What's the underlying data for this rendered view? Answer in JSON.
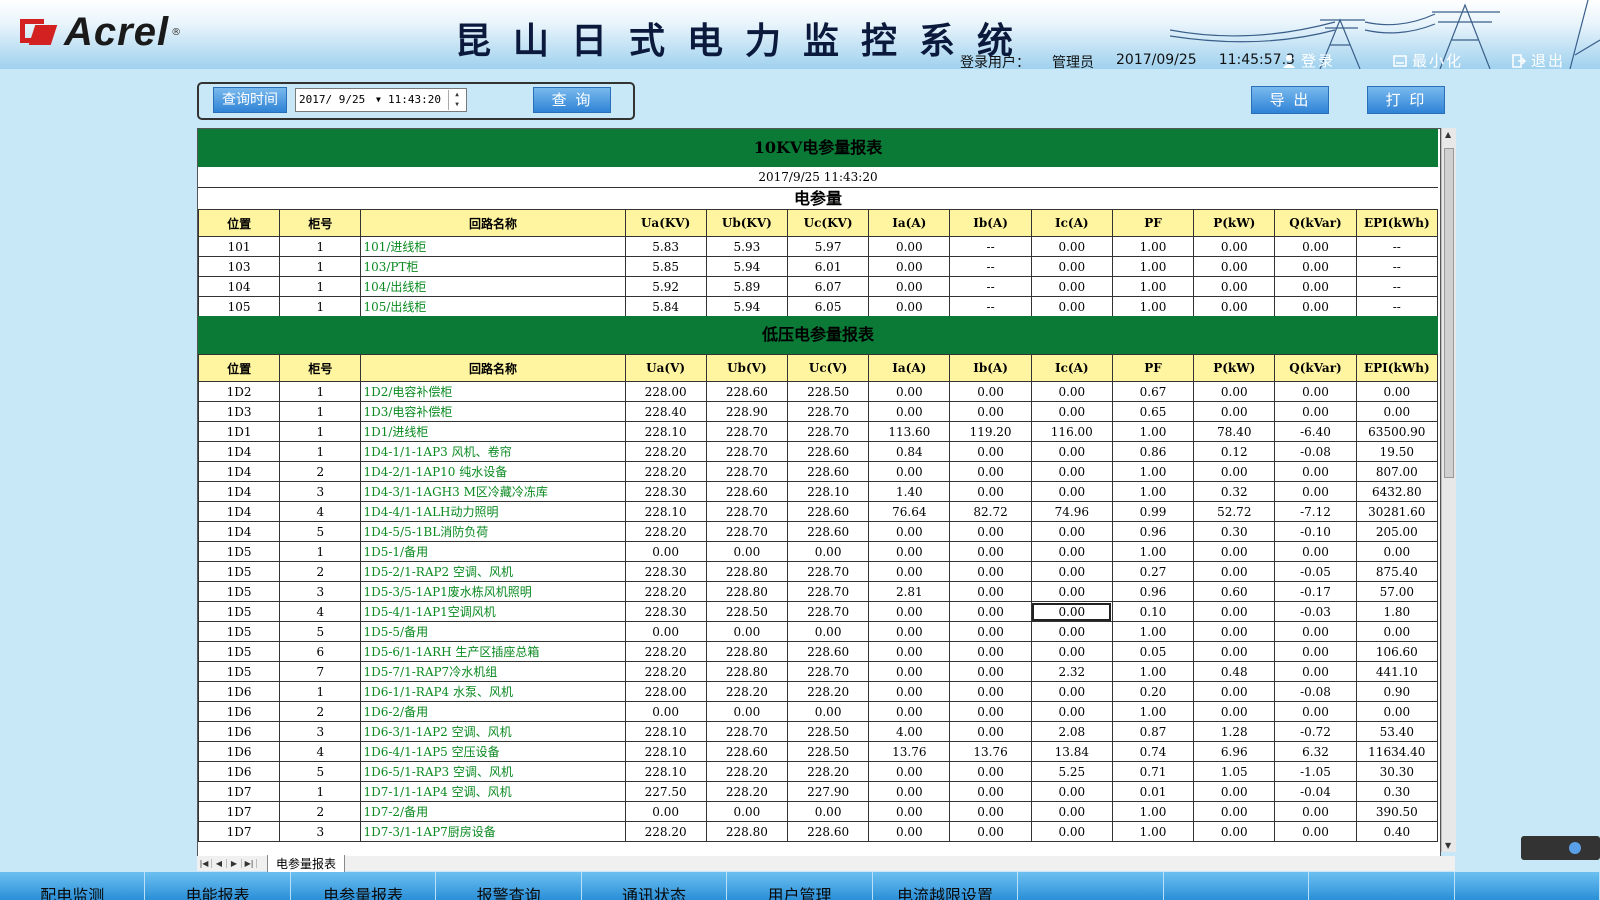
{
  "header": {
    "logo_text": "Acrel",
    "logo_reg": "®",
    "title": "昆山日式电力监控系统",
    "user_label": "登录用户：",
    "user_name": "管理员",
    "date": "2017/09/25",
    "time": "11:45:57.3",
    "login_label": "登录",
    "minimize_label": "最小化",
    "exit_label": "退出"
  },
  "query": {
    "label": "查询时间",
    "date_value": "2017/ 9/25",
    "time_value": "11:43:20",
    "query_button": "查 询",
    "export_button": "导 出",
    "print_button": "打 印"
  },
  "report": {
    "hv_title": "10KV电参量报表",
    "timestamp": "2017/9/25 11:43:20",
    "section_label": "电参量",
    "hv_columns": [
      "位置",
      "柜号",
      "回路名称",
      "Ua(KV)",
      "Ub(KV)",
      "Uc(KV)",
      "Ia(A)",
      "Ib(A)",
      "Ic(A)",
      "PF",
      "P(kW)",
      "Q(kVar)",
      "EPI(kWh)"
    ],
    "hv_rows": [
      [
        "101",
        "1",
        "101/进线柜",
        "5.83",
        "5.93",
        "5.97",
        "0.00",
        "--",
        "0.00",
        "1.00",
        "0.00",
        "0.00",
        "--"
      ],
      [
        "103",
        "1",
        "103/PT柜",
        "5.85",
        "5.94",
        "6.01",
        "0.00",
        "--",
        "0.00",
        "1.00",
        "0.00",
        "0.00",
        "--"
      ],
      [
        "104",
        "1",
        "104/出线柜",
        "5.92",
        "5.89",
        "6.07",
        "0.00",
        "--",
        "0.00",
        "1.00",
        "0.00",
        "0.00",
        "--"
      ],
      [
        "105",
        "1",
        "105/出线柜",
        "5.84",
        "5.94",
        "6.05",
        "0.00",
        "--",
        "0.00",
        "1.00",
        "0.00",
        "0.00",
        "--"
      ]
    ],
    "lv_title": "低压电参量报表",
    "lv_columns": [
      "位置",
      "柜号",
      "回路名称",
      "Ua(V)",
      "Ub(V)",
      "Uc(V)",
      "Ia(A)",
      "Ib(A)",
      "Ic(A)",
      "PF",
      "P(kW)",
      "Q(kVar)",
      "EPI(kWh)"
    ],
    "lv_rows": [
      [
        "1D2",
        "1",
        "1D2/电容补偿柜",
        "228.00",
        "228.60",
        "228.50",
        "0.00",
        "0.00",
        "0.00",
        "0.67",
        "0.00",
        "0.00",
        "0.00"
      ],
      [
        "1D3",
        "1",
        "1D3/电容补偿柜",
        "228.40",
        "228.90",
        "228.70",
        "0.00",
        "0.00",
        "0.00",
        "0.65",
        "0.00",
        "0.00",
        "0.00"
      ],
      [
        "1D1",
        "1",
        "1D1/进线柜",
        "228.10",
        "228.70",
        "228.70",
        "113.60",
        "119.20",
        "116.00",
        "1.00",
        "78.40",
        "-6.40",
        "63500.90"
      ],
      [
        "1D4",
        "1",
        "1D4-1/1-1AP3 风机、卷帘",
        "228.20",
        "228.70",
        "228.60",
        "0.84",
        "0.00",
        "0.00",
        "0.86",
        "0.12",
        "-0.08",
        "19.50"
      ],
      [
        "1D4",
        "2",
        "1D4-2/1-1AP10 纯水设备",
        "228.20",
        "228.70",
        "228.60",
        "0.00",
        "0.00",
        "0.00",
        "1.00",
        "0.00",
        "0.00",
        "807.00"
      ],
      [
        "1D4",
        "3",
        "1D4-3/1-1AGH3 M区冷藏冷冻库",
        "228.30",
        "228.60",
        "228.10",
        "1.40",
        "0.00",
        "0.00",
        "1.00",
        "0.32",
        "0.00",
        "6432.80"
      ],
      [
        "1D4",
        "4",
        "1D4-4/1-1ALH动力照明",
        "228.10",
        "228.70",
        "228.60",
        "76.64",
        "82.72",
        "74.96",
        "0.99",
        "52.72",
        "-7.12",
        "30281.60"
      ],
      [
        "1D4",
        "5",
        "1D4-5/5-1BL消防负荷",
        "228.20",
        "228.70",
        "228.60",
        "0.00",
        "0.00",
        "0.00",
        "0.96",
        "0.30",
        "-0.10",
        "205.00"
      ],
      [
        "1D5",
        "1",
        "1D5-1/备用",
        "0.00",
        "0.00",
        "0.00",
        "0.00",
        "0.00",
        "0.00",
        "1.00",
        "0.00",
        "0.00",
        "0.00"
      ],
      [
        "1D5",
        "2",
        "1D5-2/1-RAP2 空调、风机",
        "228.30",
        "228.80",
        "228.70",
        "0.00",
        "0.00",
        "0.00",
        "0.27",
        "0.00",
        "-0.05",
        "875.40"
      ],
      [
        "1D5",
        "3",
        "1D5-3/5-1AP1废水栋风机照明",
        "228.20",
        "228.80",
        "228.70",
        "2.81",
        "0.00",
        "0.00",
        "0.96",
        "0.60",
        "-0.17",
        "57.00"
      ],
      [
        "1D5",
        "4",
        "1D5-4/1-1AP1空调风机",
        "228.30",
        "228.50",
        "228.70",
        "0.00",
        "0.00",
        "0.00",
        "0.10",
        "0.00",
        "-0.03",
        "1.80"
      ],
      [
        "1D5",
        "5",
        "1D5-5/备用",
        "0.00",
        "0.00",
        "0.00",
        "0.00",
        "0.00",
        "0.00",
        "1.00",
        "0.00",
        "0.00",
        "0.00"
      ],
      [
        "1D5",
        "6",
        "1D5-6/1-1ARH 生产区插座总箱",
        "228.20",
        "228.80",
        "228.60",
        "0.00",
        "0.00",
        "0.00",
        "0.05",
        "0.00",
        "0.00",
        "106.60"
      ],
      [
        "1D5",
        "7",
        "1D5-7/1-RAP7冷水机组",
        "228.20",
        "228.80",
        "228.70",
        "0.00",
        "0.00",
        "2.32",
        "1.00",
        "0.48",
        "0.00",
        "441.10"
      ],
      [
        "1D6",
        "1",
        "1D6-1/1-RAP4 水泵、风机",
        "228.00",
        "228.20",
        "228.20",
        "0.00",
        "0.00",
        "0.00",
        "0.20",
        "0.00",
        "-0.08",
        "0.90"
      ],
      [
        "1D6",
        "2",
        "1D6-2/备用",
        "0.00",
        "0.00",
        "0.00",
        "0.00",
        "0.00",
        "0.00",
        "1.00",
        "0.00",
        "0.00",
        "0.00"
      ],
      [
        "1D6",
        "3",
        "1D6-3/1-1AP2 空调、风机",
        "228.10",
        "228.70",
        "228.50",
        "4.00",
        "0.00",
        "2.08",
        "0.87",
        "1.28",
        "-0.72",
        "53.40"
      ],
      [
        "1D6",
        "4",
        "1D6-4/1-1AP5 空压设备",
        "228.10",
        "228.60",
        "228.50",
        "13.76",
        "13.76",
        "13.84",
        "0.74",
        "6.96",
        "6.32",
        "11634.40"
      ],
      [
        "1D6",
        "5",
        "1D6-5/1-RAP3 空调、风机",
        "228.10",
        "228.20",
        "228.20",
        "0.00",
        "0.00",
        "5.25",
        "0.71",
        "1.05",
        "-1.05",
        "30.30"
      ],
      [
        "1D7",
        "1",
        "1D7-1/1-1AP4 空调、风机",
        "227.50",
        "228.20",
        "227.90",
        "0.00",
        "0.00",
        "0.00",
        "0.01",
        "0.00",
        "-0.04",
        "0.30"
      ],
      [
        "1D7",
        "2",
        "1D7-2/备用",
        "0.00",
        "0.00",
        "0.00",
        "0.00",
        "0.00",
        "0.00",
        "1.00",
        "0.00",
        "0.00",
        "390.50"
      ],
      [
        "1D7",
        "3",
        "1D7-3/1-1AP7厨房设备",
        "228.20",
        "228.80",
        "228.60",
        "0.00",
        "0.00",
        "0.00",
        "1.00",
        "0.00",
        "0.00",
        "0.40"
      ]
    ],
    "sheet_tab": "电参量报表"
  },
  "nav": [
    "配电监测",
    "电能报表",
    "电参量报表",
    "报警查询",
    "通讯状态",
    "用户管理",
    "电流越限设置",
    "",
    "",
    "",
    ""
  ],
  "colors": {
    "green_band": "#0a7a36",
    "header_yellow": "#fff4a0",
    "name_green": "#0a8a20",
    "nav_blue": "#2a8fd8"
  },
  "icons": [
    "user-icon",
    "minimize-icon",
    "exit-icon",
    "dropdown-icon",
    "spinner-icon"
  ]
}
